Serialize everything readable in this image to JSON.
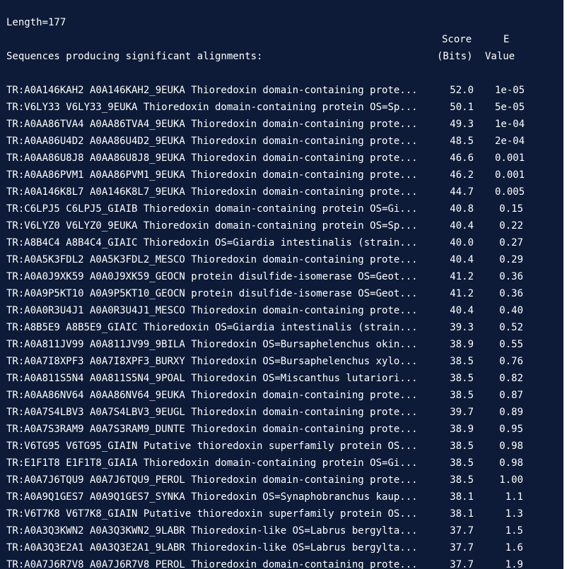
{
  "length_line": "Length=177",
  "header": {
    "sequences_label": "Sequences producing significant alignments:",
    "score_label": "Score",
    "bits_label": "(Bits)",
    "e_label": "E",
    "value_label": "Value"
  },
  "rows": [
    {
      "desc": "TR:A0A146KAH2 A0A146KAH2_9EUKA Thioredoxin domain-containing prote...",
      "score": "52.0",
      "evalue": "1e-05"
    },
    {
      "desc": "TR:V6LY33 V6LY33_9EUKA Thioredoxin domain-containing protein OS=Sp...",
      "score": "50.1",
      "evalue": "5e-05"
    },
    {
      "desc": "TR:A0AA86TVA4 A0AA86TVA4_9EUKA Thioredoxin domain-containing prote...",
      "score": "49.3",
      "evalue": "1e-04"
    },
    {
      "desc": "TR:A0AA86U4D2 A0AA86U4D2_9EUKA Thioredoxin domain-containing prote...",
      "score": "48.5",
      "evalue": "2e-04"
    },
    {
      "desc": "TR:A0AA86U8J8 A0AA86U8J8_9EUKA Thioredoxin domain-containing prote...",
      "score": "46.6",
      "evalue": "0.001"
    },
    {
      "desc": "TR:A0AA86PVM1 A0AA86PVM1_9EUKA Thioredoxin domain-containing prote...",
      "score": "46.2",
      "evalue": "0.001"
    },
    {
      "desc": "TR:A0A146K8L7 A0A146K8L7_9EUKA Thioredoxin domain-containing prote...",
      "score": "44.7",
      "evalue": "0.005"
    },
    {
      "desc": "TR:C6LPJ5 C6LPJ5_GIAIB Thioredoxin domain-containing protein OS=Gi...",
      "score": "40.8",
      "evalue": "0.15"
    },
    {
      "desc": "TR:V6LYZ0 V6LYZ0_9EUKA Thioredoxin domain-containing protein OS=Sp...",
      "score": "40.4",
      "evalue": "0.22"
    },
    {
      "desc": "TR:A8B4C4 A8B4C4_GIAIC Thioredoxin OS=Giardia intestinalis (strain...",
      "score": "40.0",
      "evalue": "0.27"
    },
    {
      "desc": "TR:A0A5K3FDL2 A0A5K3FDL2_MESCO Thioredoxin domain-containing prote...",
      "score": "40.4",
      "evalue": "0.29"
    },
    {
      "desc": "TR:A0A0J9XK59 A0A0J9XK59_GEOCN protein disulfide-isomerase OS=Geot...",
      "score": "41.2",
      "evalue": "0.36"
    },
    {
      "desc": "TR:A0A9P5KT10 A0A9P5KT10_GEOCN protein disulfide-isomerase OS=Geot...",
      "score": "41.2",
      "evalue": "0.36"
    },
    {
      "desc": "TR:A0A0R3U4J1 A0A0R3U4J1_MESCO Thioredoxin domain-containing prote...",
      "score": "40.4",
      "evalue": "0.40"
    },
    {
      "desc": "TR:A8B5E9 A8B5E9_GIAIC Thioredoxin OS=Giardia intestinalis (strain...",
      "score": "39.3",
      "evalue": "0.52"
    },
    {
      "desc": "TR:A0A811JV99 A0A811JV99_9BILA Thioredoxin OS=Bursaphelenchus okin...",
      "score": "38.9",
      "evalue": "0.55"
    },
    {
      "desc": "TR:A0A7I8XPF3 A0A7I8XPF3_BURXY Thioredoxin OS=Bursaphelenchus xylo...",
      "score": "38.5",
      "evalue": "0.76"
    },
    {
      "desc": "TR:A0A811S5N4 A0A811S5N4_9POAL Thioredoxin OS=Miscanthus lutariori...",
      "score": "38.5",
      "evalue": "0.82"
    },
    {
      "desc": "TR:A0AA86NV64 A0AA86NV64_9EUKA Thioredoxin domain-containing prote...",
      "score": "38.5",
      "evalue": "0.87"
    },
    {
      "desc": "TR:A0A7S4LBV3 A0A7S4LBV3_9EUGL Thioredoxin domain-containing prote...",
      "score": "39.7",
      "evalue": "0.89"
    },
    {
      "desc": "TR:A0A7S3RAM9 A0A7S3RAM9_DUNTE Thioredoxin domain-containing prote...",
      "score": "38.9",
      "evalue": "0.95"
    },
    {
      "desc": "TR:V6TG95 V6TG95_GIAIN Putative thioredoxin superfamily protein OS...",
      "score": "38.5",
      "evalue": "0.98"
    },
    {
      "desc": "TR:E1F1T8 E1F1T8_GIAIA Thioredoxin domain-containing protein OS=Gi...",
      "score": "38.5",
      "evalue": "0.98"
    },
    {
      "desc": "TR:A0A7J6TQU9 A0A7J6TQU9_PEROL Thioredoxin domain-containing prote...",
      "score": "38.5",
      "evalue": "1.00"
    },
    {
      "desc": "TR:A0A9Q1GES7 A0A9Q1GES7_SYNKA Thioredoxin OS=Synaphobranchus kaup...",
      "score": "38.1",
      "evalue": "1.1"
    },
    {
      "desc": "TR:V6T7K8 V6T7K8_GIAIN Putative thioredoxin superfamily protein OS...",
      "score": "38.1",
      "evalue": "1.3"
    },
    {
      "desc": "TR:A0A3Q3KWN2 A0A3Q3KWN2_9LABR Thioredoxin-like OS=Labrus bergylta...",
      "score": "37.7",
      "evalue": "1.5"
    },
    {
      "desc": "TR:A0A3Q3E2A1 A0A3Q3E2A1_9LABR Thioredoxin-like OS=Labrus bergylta...",
      "score": "37.7",
      "evalue": "1.6"
    },
    {
      "desc": "TR:A0A7J6R7V8 A0A7J6R7V8_PEROL Thioredoxin domain-containing prote...",
      "score": "37.7",
      "evalue": "1.9"
    }
  ],
  "colors": {
    "background": "#0d1b38",
    "text": "#ffffff"
  }
}
